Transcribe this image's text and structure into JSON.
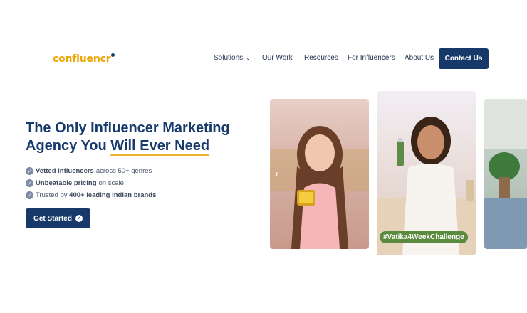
{
  "logo": {
    "text": "confluencr"
  },
  "nav": {
    "items": [
      {
        "label": "Solutions",
        "has_dropdown": true
      },
      {
        "label": "Our Work"
      },
      {
        "label": "Resources"
      },
      {
        "label": "For Influencers"
      },
      {
        "label": "About Us"
      }
    ],
    "contact_label": "Contact Us"
  },
  "hero": {
    "title_line1": "The Only Influencer Marketing",
    "title_line2_prefix": "Agency You ",
    "title_highlight": "Will Ever Need",
    "features": [
      {
        "bold": "Vetted influencers",
        "rest": "across 50+ genres"
      },
      {
        "bold": "Unbeatable pricing",
        "rest": "on scale"
      },
      {
        "prefix": "Trusted by ",
        "bold": "400+ leading Indian brands"
      }
    ],
    "cta_label": "Get Started"
  },
  "carousel": {
    "prev_arrow": "‹",
    "card2_tag": "#Vatika4WeekChallenge"
  },
  "colors": {
    "brand": "#16396a",
    "accent": "#f0a500"
  }
}
